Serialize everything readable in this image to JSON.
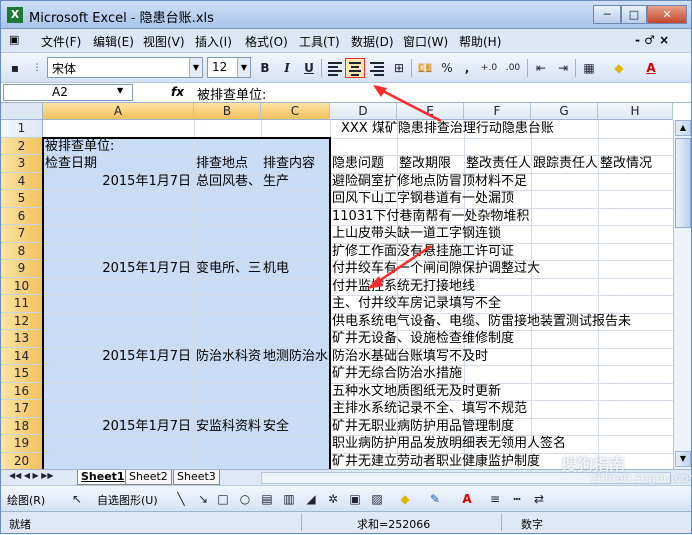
{
  "window": {
    "title": "Microsoft Excel - 隐患台账.xls",
    "app_icon": "excel-icon",
    "min_label": "─",
    "restore_label": "□",
    "close_label": "✕"
  },
  "menu": {
    "items": [
      "文件(F)",
      "编辑(E)",
      "视图(V)",
      "插入(I)",
      "格式(O)",
      "工具(T)",
      "数据(D)",
      "窗口(W)",
      "帮助(H)"
    ],
    "right_controls": "- ♂ ×"
  },
  "toolbar": {
    "font_name": "宋体",
    "font_size": "12",
    "bold": "B",
    "italic": "I",
    "underline": "U",
    "align_left": "align-left-icon",
    "align_center": "align-center-icon",
    "align_right": "align-right-icon",
    "merge": "⊞",
    "currency": "🝖",
    "percent": "%",
    "comma": ",",
    "inc_decimal": "+.0",
    "dec_decimal": ".00",
    "indent_dec": "⇤",
    "indent_inc": "⇥",
    "borders": "▦",
    "fill_color": "◆",
    "font_color": "A",
    "accent": "#ff2a2a"
  },
  "formula_bar": {
    "name_box": "A2",
    "fx_label": "fx",
    "content": "被排查单位:"
  },
  "sheet": {
    "columns": [
      "A",
      "B",
      "C",
      "D",
      "E",
      "F",
      "G",
      "H"
    ],
    "rows": [
      "1",
      "2",
      "3",
      "4",
      "5",
      "6",
      "7",
      "8",
      "9",
      "10",
      "11",
      "12",
      "13",
      "14",
      "15",
      "16",
      "17",
      "18",
      "19",
      "20"
    ],
    "title": "XXX 煤矿隐患排查治理行动隐患台账",
    "a2": "被排查单位:",
    "a3": "检查日期",
    "b3": "排查地点",
    "c3": "排查内容",
    "d3": "隐患问题",
    "e3": "整改期限",
    "f3": "整改责任人",
    "g3": "跟踪责任人",
    "h3": "整改情况",
    "r4": {
      "a": "2015年1月7日",
      "b": "总回风巷、",
      "c": "生产",
      "d": "避险硐室扩修地点防冒顶材料不足"
    },
    "r5": {
      "d": "回风下山工字钢巷道有一处漏顶"
    },
    "r6": {
      "d": "11031下付巷南帮有一处杂物堆积"
    },
    "r7": {
      "d": "上山皮带头缺一道工字钢连锁"
    },
    "r8": {
      "d": "扩修工作面没有悬挂施工许可证"
    },
    "r9": {
      "a": "2015年1月7日",
      "b": "变电所、三",
      "c": "机电",
      "d": "付井绞车有一个闸间隙保护调整过大"
    },
    "r10": {
      "d": "付井监控系统无打接地线"
    },
    "r11": {
      "d": "主、付井绞车房记录填写不全"
    },
    "r12": {
      "d": "供电系统电气设备、电缆、防雷接地装置测试报告未"
    },
    "r13": {
      "d": "矿井无设备、设施检查维修制度"
    },
    "r14": {
      "a": "2015年1月7日",
      "b": "防治水科资",
      "c": "地测防治水",
      "d": "防治水基础台账填写不及时"
    },
    "r15": {
      "d": "矿井无综合防治水措施"
    },
    "r16": {
      "d": "五种水文地质图纸无及时更新"
    },
    "r17": {
      "d": "主排水系统记录不全、填写不规范"
    },
    "r18": {
      "a": "2015年1月7日",
      "b": "安监科资料",
      "c": "安全",
      "d": "矿井无职业病防护用品管理制度"
    },
    "r19": {
      "d": "职业病防护用品发放明细表无领用人签名"
    },
    "r20": {
      "d": "矿井无建立劳动者职业健康监护制度"
    }
  },
  "tabs": {
    "nav": "◀◀ ◀ ▶ ▶▶",
    "sheets": [
      "Sheet1",
      "Sheet2",
      "Sheet3"
    ]
  },
  "drawing": {
    "draw_label": "绘图(R)",
    "autoshape_label": "自选图形(U)"
  },
  "status": {
    "ready": "就绪",
    "sum": "求和=252066",
    "num": "数字"
  },
  "watermark": {
    "line1": "搜狗指南",
    "line2": "zhinan.sogou.com"
  }
}
